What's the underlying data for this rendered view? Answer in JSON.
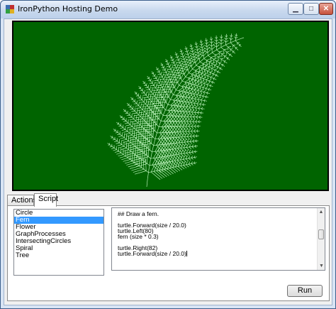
{
  "window": {
    "title": "IronPython Hosting Demo",
    "icons": {
      "app": "python-app-icon",
      "minimize": "minimize-icon",
      "maximize": "maximize-icon",
      "close": "close-icon"
    }
  },
  "canvas": {
    "background_color": "#006400",
    "drawing_color": "#b8f0b8",
    "content": "fern-fractal-drawing"
  },
  "tabs": [
    {
      "label": "Actions",
      "selected": false
    },
    {
      "label": "Script",
      "selected": true
    }
  ],
  "scripts": {
    "items": [
      "Circle",
      "Fern",
      "Flower",
      "GraphProcesses",
      "IntersectingCircles",
      "Spiral",
      "Tree"
    ],
    "selected": "Fern"
  },
  "editor": {
    "lines": [
      "## Draw a fern.",
      "",
      "turtle.Forward(size / 20.0)",
      "turtle.Left(80)",
      "fern (size * 0.3)",
      "",
      "turtle.Right(82)",
      "turtle.Forward(size / 20.0)"
    ]
  },
  "run_button": {
    "label": "Run"
  }
}
